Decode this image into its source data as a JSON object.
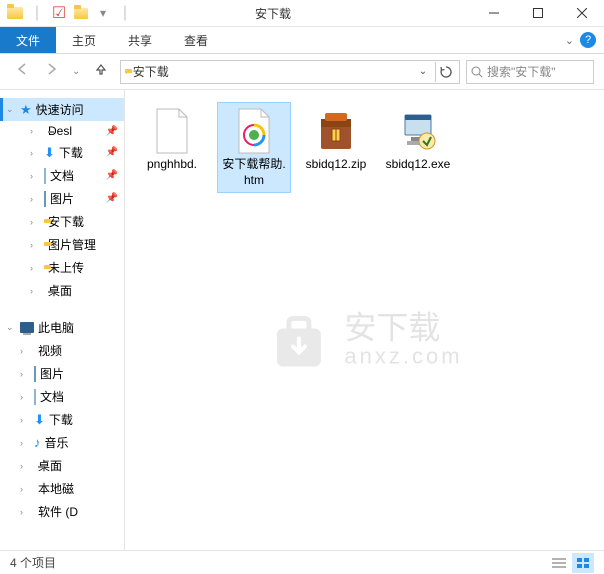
{
  "titlebar": {
    "title": "安下载"
  },
  "ribbon": {
    "file": "文件",
    "home": "主页",
    "share": "共享",
    "view": "查看"
  },
  "nav": {
    "crumb_root_icon": "folder",
    "crumb1": "安下载",
    "search_placeholder": "搜索\"安下载\""
  },
  "sidebar": {
    "quick_access": "快速访问",
    "this_pc": "此电脑",
    "quick_items": [
      {
        "label": "Desl",
        "icon": "desktop",
        "pinned": true
      },
      {
        "label": "下载",
        "icon": "download",
        "pinned": true
      },
      {
        "label": "文档",
        "icon": "doc",
        "pinned": true
      },
      {
        "label": "图片",
        "icon": "pic",
        "pinned": true
      },
      {
        "label": "安下载",
        "icon": "folder"
      },
      {
        "label": "图片管理",
        "icon": "folder"
      },
      {
        "label": "未上传",
        "icon": "folder"
      },
      {
        "label": "桌面",
        "icon": "desktop"
      }
    ],
    "pc_items": [
      {
        "label": "视频",
        "icon": "video"
      },
      {
        "label": "图片",
        "icon": "pic"
      },
      {
        "label": "文档",
        "icon": "doc"
      },
      {
        "label": "下载",
        "icon": "download"
      },
      {
        "label": "音乐",
        "icon": "music"
      },
      {
        "label": "桌面",
        "icon": "desktop"
      },
      {
        "label": "本地磁",
        "icon": "drive-os"
      },
      {
        "label": "软件 (D",
        "icon": "drive"
      }
    ]
  },
  "files": [
    {
      "name": "pnghhbd.",
      "type": "blank"
    },
    {
      "name": "安下载帮助.htm",
      "type": "htm",
      "selected": true
    },
    {
      "name": "sbidq12.zip",
      "type": "zip"
    },
    {
      "name": "sbidq12.exe",
      "type": "exe"
    }
  ],
  "status": {
    "text": "4 个项目"
  },
  "watermark": {
    "line1": "安下载",
    "line2": "anxz.com"
  }
}
